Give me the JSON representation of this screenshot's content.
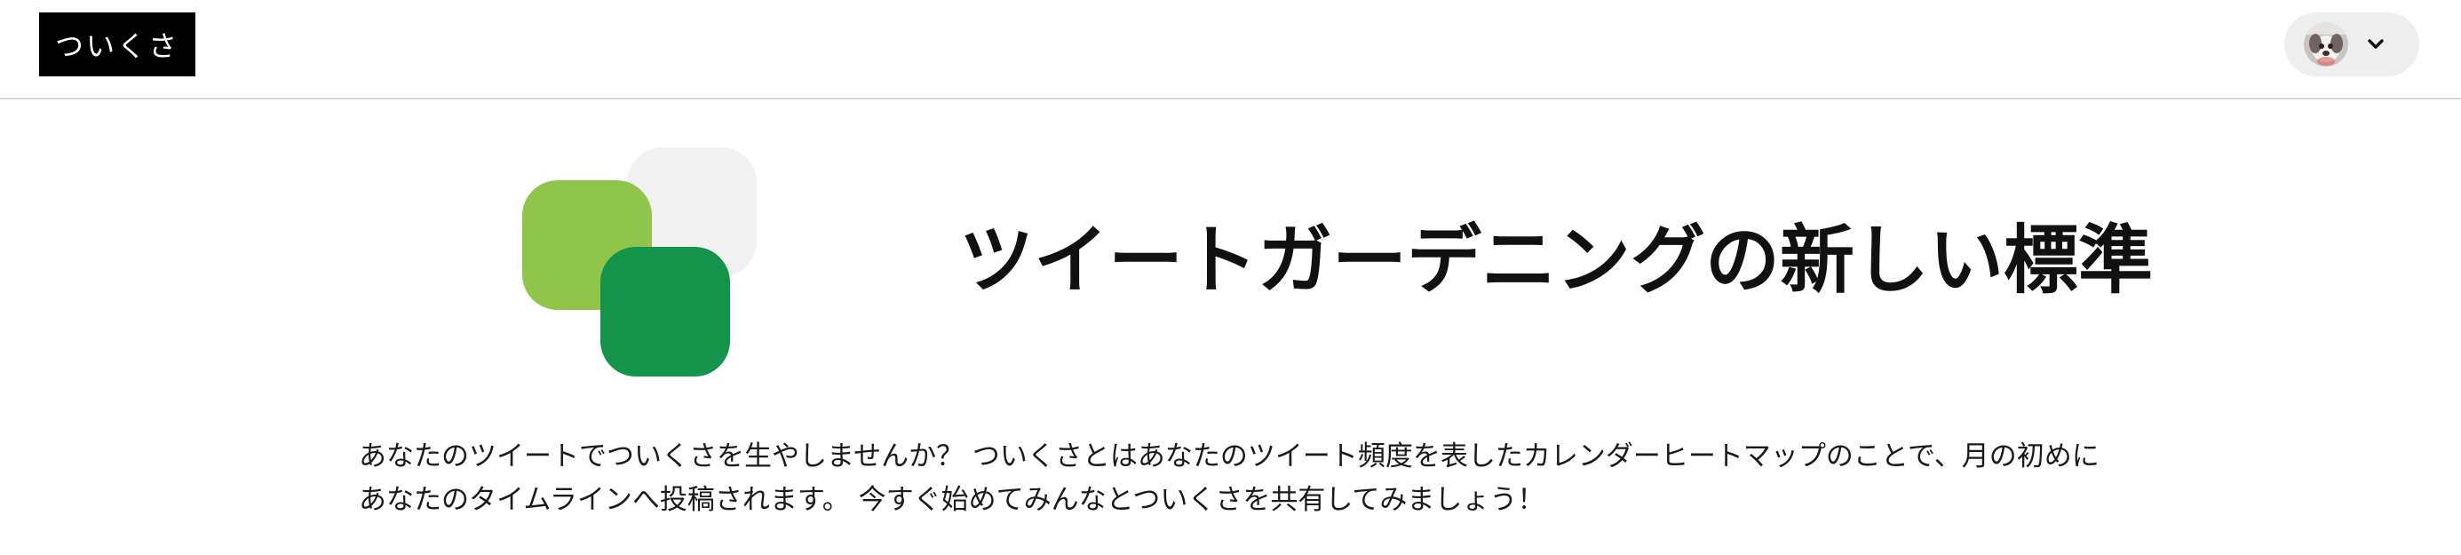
{
  "header": {
    "logo_label": "ついくさ",
    "user_menu": {
      "avatar_icon": "user-avatar",
      "chevron_icon": "chevron-down-icon"
    }
  },
  "hero": {
    "logo_icon": "tsuikusa-squares-logo",
    "logo_colors": {
      "back_square": "#f1f1f1",
      "light_green": "#8fc54a",
      "dark_green": "#14944a"
    },
    "title": "ツイートガーデニングの新しい標準"
  },
  "description": "あなたのツイートでついくさを生やしませんか？ ついくさとはあなたのツイート頻度を表したカレンダーヒートマップのことで、月の初めにあなたのタイムラインへ投稿されます。 今すぐ始めてみんなとついくさを共有してみましょう！"
}
